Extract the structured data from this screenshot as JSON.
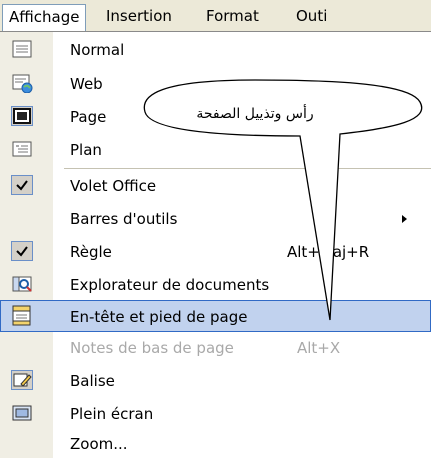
{
  "menubar": {
    "items": [
      "Affichage",
      "Insertion",
      "Format",
      "Outi"
    ]
  },
  "menu": {
    "items": [
      {
        "label": "Normal",
        "icon": "normal-view-icon"
      },
      {
        "label": "Web",
        "icon": "web-layout-icon"
      },
      {
        "label": "Page",
        "icon": "page-layout-icon",
        "checked": true
      },
      {
        "label": "Plan",
        "icon": "outline-view-icon"
      },
      {
        "label": "Volet Office",
        "icon": "checkmark-icon",
        "checked": true
      },
      {
        "label": "Barres d'outils",
        "submenu": true
      },
      {
        "label": "Règle",
        "icon": "checkmark-icon",
        "checked": true,
        "shortcut": "Alt+Maj+R"
      },
      {
        "label": "Explorateur de documents",
        "icon": "document-map-icon"
      },
      {
        "label": "En-tête et pied de page",
        "icon": "header-footer-icon",
        "selected": true
      },
      {
        "label": "Notes de bas de page",
        "shortcut": "Alt+X",
        "disabled": true
      },
      {
        "label": "Balise",
        "icon": "markup-icon"
      },
      {
        "label": "Plein écran",
        "icon": "full-screen-icon"
      },
      {
        "label": "Zoom...",
        "icon": ""
      }
    ]
  },
  "callout": {
    "text": "رأس وتذييل الصفحة"
  },
  "colors": {
    "menubar_bg": "#ece9d8",
    "gutter_bg": "#f0eee4",
    "selected_bg": "#c1d2ee",
    "selected_border": "#316ac5",
    "disabled_text": "#a9a9a9"
  }
}
